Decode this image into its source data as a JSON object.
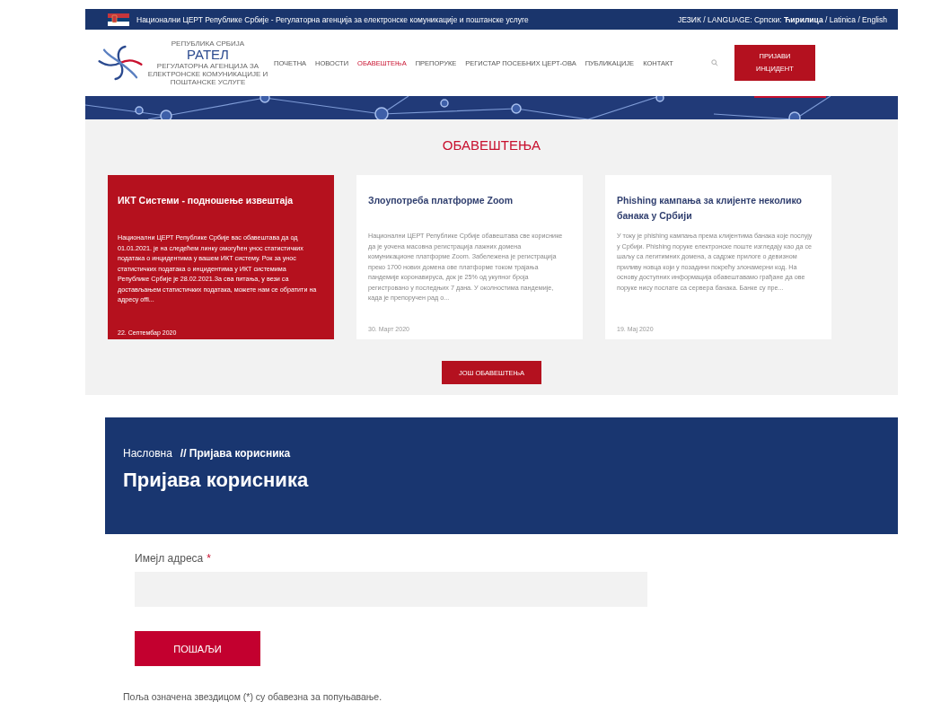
{
  "top_bar": {
    "site_title": "Национални ЦЕРТ Републике Србије - Регулаторна агенција за електронске комуникације и поштанске услуге",
    "language": "ЈЕЗИК / LANGUAGE: Српски: **Ћирилица** / Latinica / English"
  },
  "logo": {
    "overline": "РЕПУБЛИКА СРБИЈА",
    "name": "РАТЕЛ",
    "subtitle": "РЕГУЛАТОРНА АГЕНЦИЈА ЗА ЕЛЕКТРОНСКЕ КОМУНИКАЦИЈЕ И ПОШТАНСКЕ УСЛУГЕ"
  },
  "nav": [
    {
      "label": "ПОЧЕТНА",
      "selected": false
    },
    {
      "label": "НОВОСТИ",
      "selected": false
    },
    {
      "label": "ОБАВЕШТЕЊА",
      "selected": true
    },
    {
      "label": "ПРЕПОРУКЕ",
      "selected": false
    },
    {
      "label": "РЕГИСТАР ПОСЕБНИХ ЦЕРТ-ОВА",
      "selected": false
    },
    {
      "label": "ПУБЛИКАЦИЈЕ",
      "selected": false
    },
    {
      "label": "КОНТАКТ",
      "selected": false
    }
  ],
  "report_button": "ПРИЈАВИ ИНЦИДЕНТ",
  "notices": {
    "heading": "ОБАВЕШТЕЊА",
    "cards": [
      {
        "title": "ИКТ Системи - подношење извештаја",
        "text": "Национални ЦЕРТ Републике Србије вас обавештава да од 01.01.2021. је на следећем линку омогућен унос статистичких података о инцидентима у вашем ИКТ систему. Рок за унос статистичких података о инцидентима у ИКТ системима Републике Србије је 28.02.2021.За сва питања, у вези са достављањем статистичких података, можете нам се обратити на адресу offi...",
        "date": "22. Септембар 2020",
        "highlighted": true
      },
      {
        "title": "Злоупотреба платформе Zoom",
        "text": "Национални ЦЕРТ Републике Србије обавештава све кориснике да је уочена масовна регистрација лажних домена комуникационе платформе Zoom. Забележена је регистрација преко 1700 нових домена ове платформе током трајања пандемије коронавируса, док је 25% од укупног броја регистровано у последњих 7 дана. У околностима пандемије, када је препоручен рад о...",
        "date": "30. Март 2020",
        "highlighted": false
      },
      {
        "title": "Phishing кампања за клијенте неколико банака у Србији",
        "text": "У току је phishing кампања према клијентима банака које послују у Србији. Phishing поруке електронске поште изгледају као да се шаљу са легитимних домена, а садрже прилоге о девизном приливу новца који у позадини покрећу злонамерни код. На основу доступних информација обавештавамо грађане да ове поруке нису послате са сервера банака. Банке су пре...",
        "date": "19. Мај 2020",
        "highlighted": false
      }
    ],
    "more_button": "ЈОШ ОБАВЕШТЕЊА"
  },
  "login": {
    "breadcrumb": [
      {
        "label": "Насловна",
        "current": false
      },
      {
        "label": "// Пријава корисника",
        "current": true
      }
    ],
    "title": "Пријава корисника",
    "email_label": "Имејл адреса",
    "required_mark": "*",
    "submit": "ПОШАЉИ",
    "note": "Поља означена звездицом (*) су обавезна за попуњавање."
  }
}
